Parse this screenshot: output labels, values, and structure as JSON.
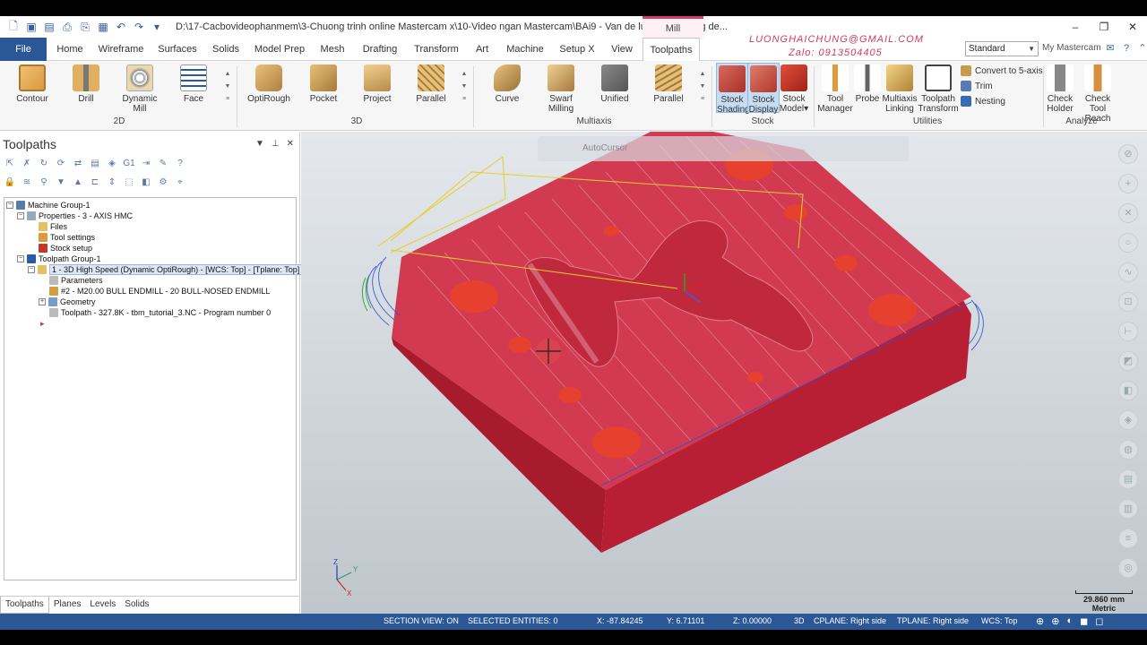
{
  "title": {
    "path": "D:\\17-Cacbovideophanmem\\3-Chuong trinh online Mastercam x\\10-Video ngan Mastercam\\BAi9 - Van de luong du khong de...",
    "context_tab": "Mill",
    "window_buttons": [
      "–",
      "❐",
      "✕"
    ]
  },
  "tabs": {
    "file": "File",
    "home": "Home",
    "wireframe": "Wireframe",
    "surfaces": "Surfaces",
    "solids": "Solids",
    "model_prep": "Model Prep",
    "mesh": "Mesh",
    "drafting": "Drafting",
    "transform": "Transform",
    "art": "Art",
    "machine": "Machine",
    "setup_x": "Setup X",
    "view": "View",
    "toolpaths": "Toolpaths"
  },
  "overlay": {
    "email": "LUONGHAICHUNG@GMAIL.COM",
    "zalo": "Zalo: 0913504405"
  },
  "ribbon_right": {
    "workspace": "Standard",
    "my_mastercam": "My Mastercam"
  },
  "ribbon": {
    "g2d": {
      "label": "2D",
      "contour": "Contour",
      "drill": "Drill",
      "dynamic_mill": "Dynamic Mill",
      "face": "Face"
    },
    "g3d": {
      "label": "3D",
      "optirough": "OptiRough",
      "pocket": "Pocket",
      "project": "Project",
      "parallel": "Parallel"
    },
    "multiaxis": {
      "label": "Multiaxis",
      "curve": "Curve",
      "swarf": "Swarf Milling",
      "unified": "Unified",
      "parallel": "Parallel"
    },
    "stock": {
      "label": "Stock",
      "shading_1": "Stock",
      "shading_2": "Shading",
      "display_1": "Stock",
      "display_2": "Display",
      "model_1": "Stock",
      "model_2": "Model"
    },
    "utilities": {
      "label": "Utilities",
      "tool_mgr_1": "Tool",
      "tool_mgr_2": "Manager",
      "probe": "Probe",
      "ml_1": "Multiaxis",
      "ml_2": "Linking",
      "tt_1": "Toolpath",
      "tt_2": "Transform",
      "convert": "Convert to 5-axis",
      "trim": "Trim",
      "nesting": "Nesting"
    },
    "analyze": {
      "label": "Analyze",
      "ch_1": "Check",
      "ch_2": "Holder",
      "ctr_1": "Check",
      "ctr_2": "Tool Reach"
    }
  },
  "panel": {
    "title": "Toolpaths",
    "tree": {
      "machine_group": "Machine Group-1",
      "properties": "Properties - 3 - AXIS HMC",
      "files": "Files",
      "tool_settings": "Tool settings",
      "stock_setup": "Stock setup",
      "toolpath_group": "Toolpath Group-1",
      "op1": "1 - 3D High Speed (Dynamic OptiRough) - [WCS: Top] - [Tplane: Top]",
      "parameters": "Parameters",
      "tool": "#2 - M20.00 BULL ENDMILL - 20 BULL-NOSED ENDMILL",
      "geometry": "Geometry",
      "toolpath": "Toolpath - 327.8K - tbm_tutorial_3.NC - Program number 0"
    },
    "bottom_tabs": [
      "Toolpaths",
      "Planes",
      "Levels",
      "Solids"
    ]
  },
  "viewport": {
    "autocursor": "AutoCursor",
    "scale_value": "29.860 mm",
    "scale_unit": "Metric",
    "axis_x": "X",
    "axis_y": "Y",
    "axis_z": "Z"
  },
  "statusbar": {
    "section_view": "SECTION VIEW: ON",
    "selected": "SELECTED ENTITIES: 0",
    "x": "X:   -87.84245",
    "y": "Y:   6.71101",
    "z": "Z:   0.00000",
    "mode": "3D",
    "cplane": "CPLANE: Right side",
    "tplane": "TPLANE: Right side",
    "wcs": "WCS: Top"
  },
  "colors": {
    "accent": "#2b5797",
    "stock": "#c8203a",
    "toolpath_blue": "#3a5ad8",
    "toolpath_yellow": "#e0d020"
  }
}
